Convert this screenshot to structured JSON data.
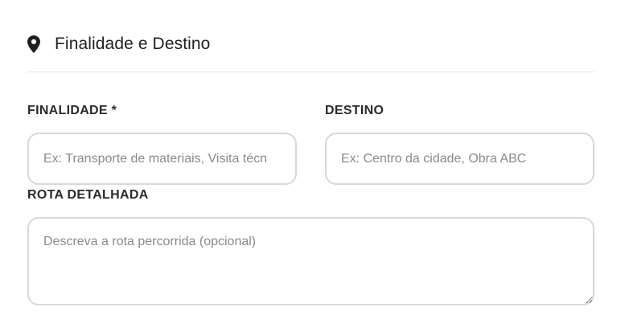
{
  "section": {
    "icon": "map-pin-icon",
    "title": "Finalidade e Destino"
  },
  "fields": {
    "finalidade": {
      "label": "FINALIDADE *",
      "placeholder": "Ex: Transporte de materiais, Visita técn",
      "value": ""
    },
    "destino": {
      "label": "DESTINO",
      "placeholder": "Ex: Centro da cidade, Obra ABC",
      "value": ""
    },
    "rota": {
      "label": "ROTA DETALHADA",
      "placeholder": "Descreva a rota percorrida (opcional)",
      "value": ""
    }
  }
}
